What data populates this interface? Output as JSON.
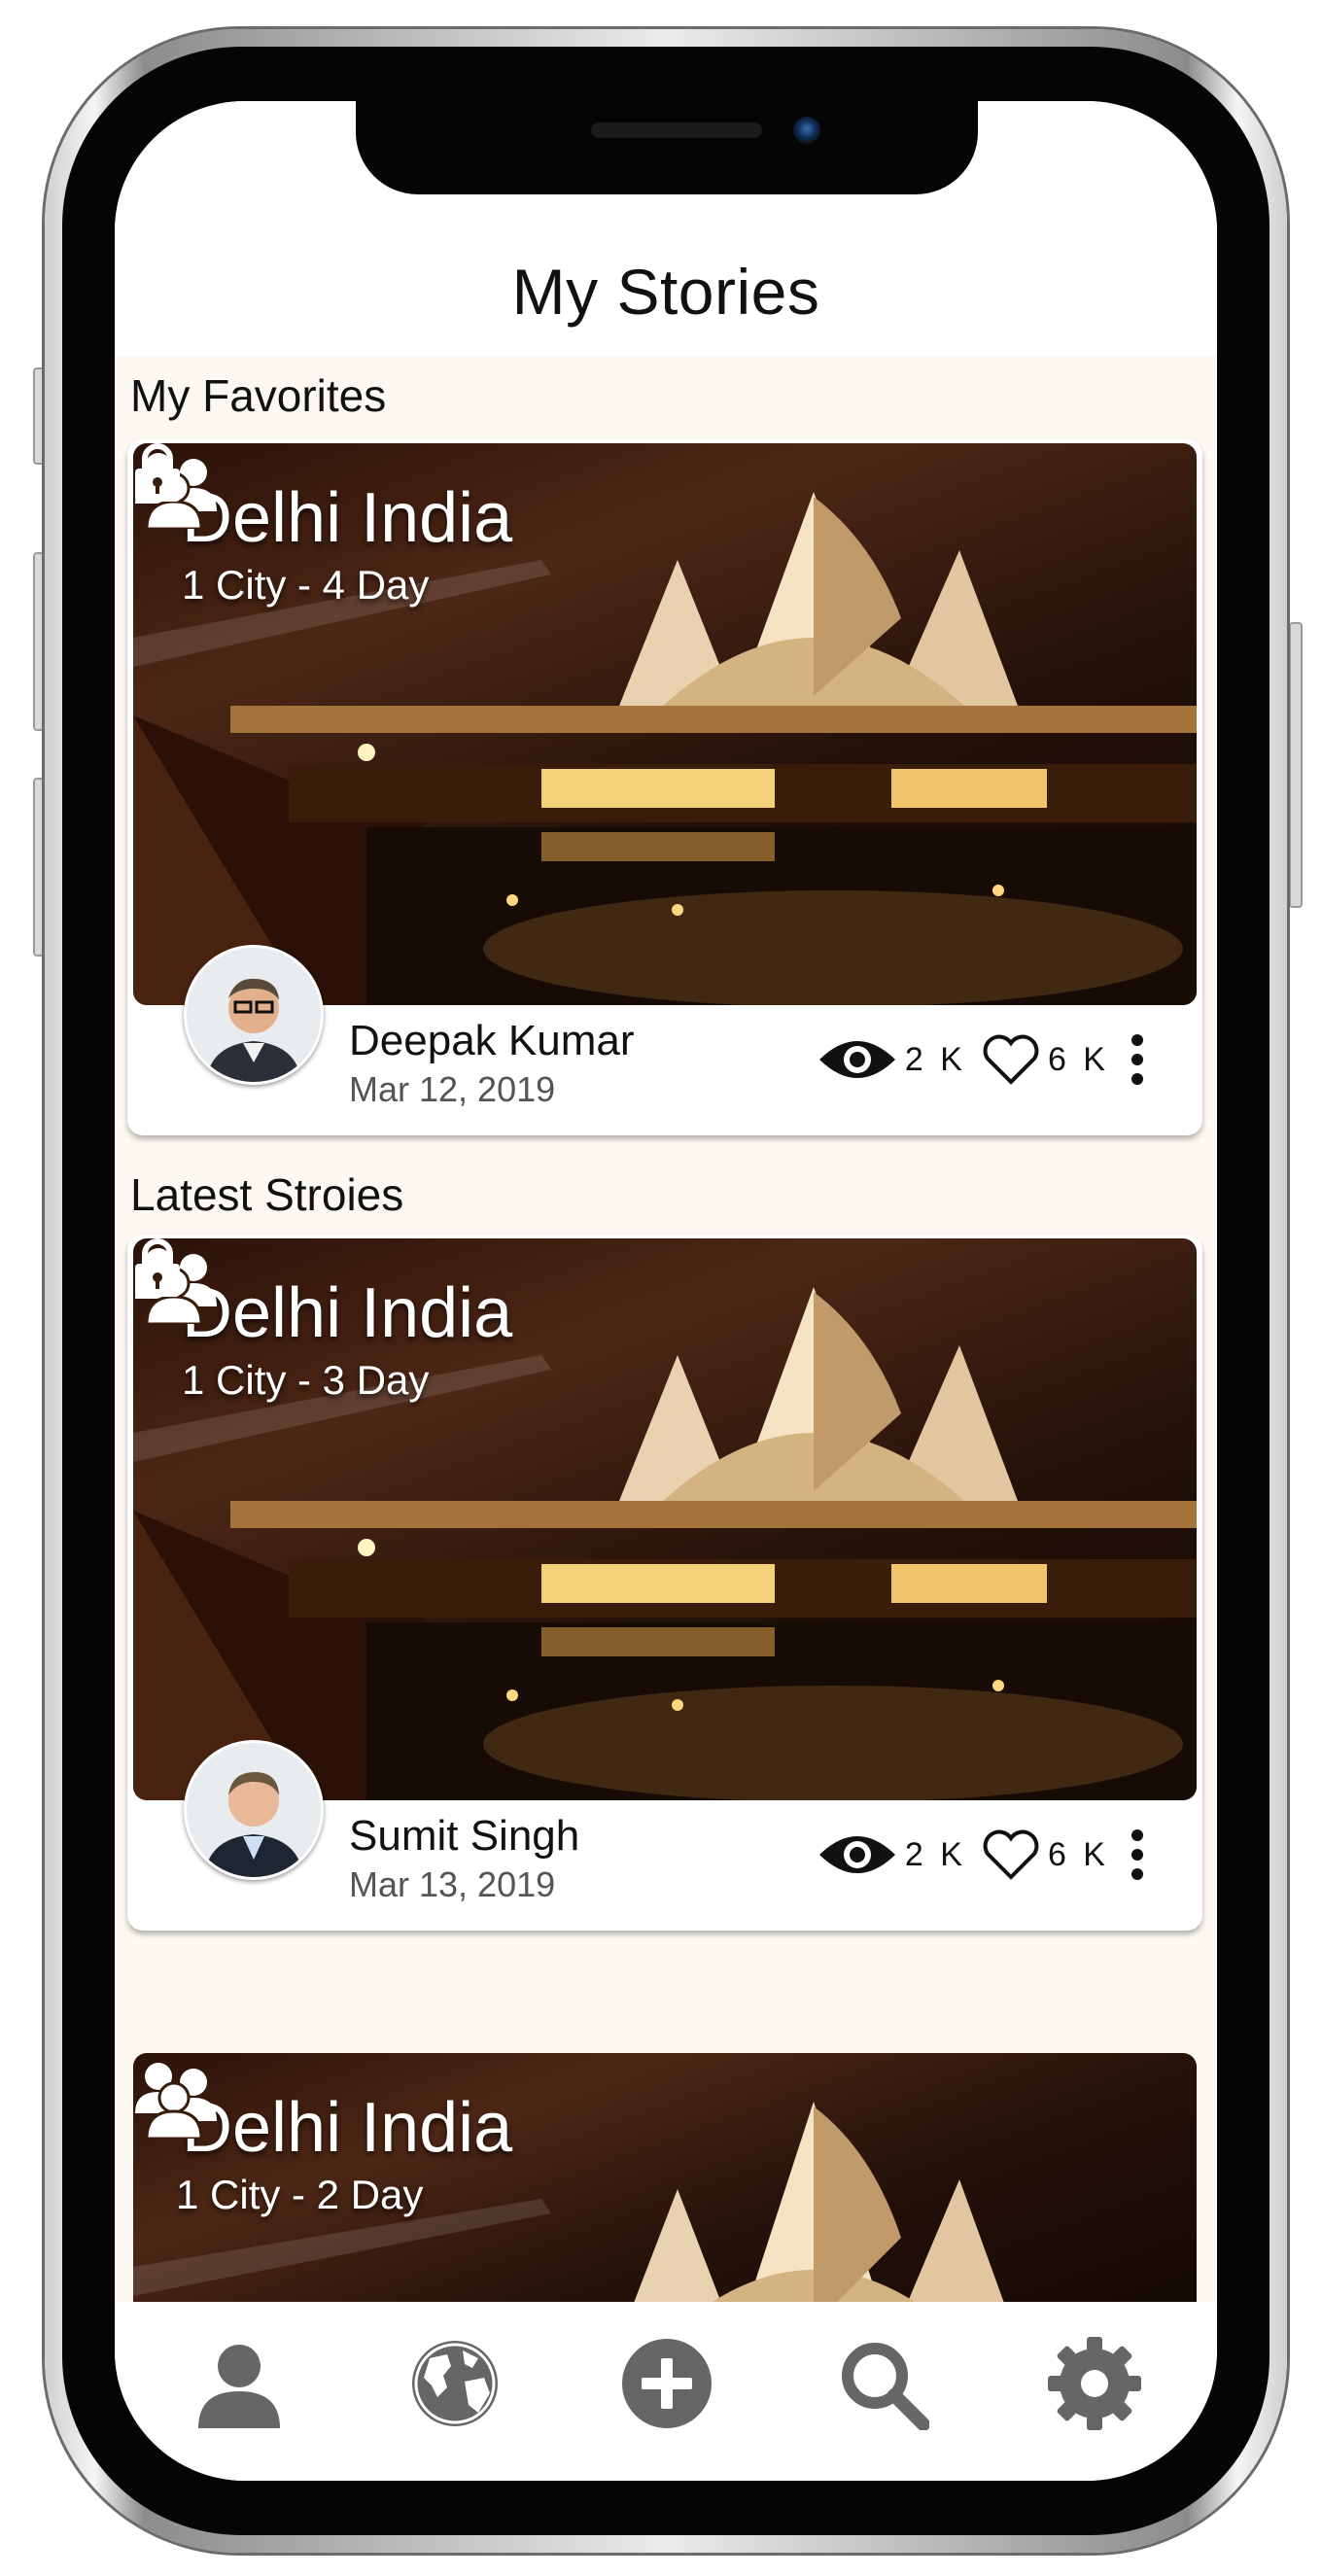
{
  "header": {
    "title": "My Stories"
  },
  "sections": {
    "favorites": "My Favorites",
    "latest": "Latest Stroies"
  },
  "stories": [
    {
      "city": "Delhi India",
      "duration": "1 City - 4 Day",
      "author": "Deepak Kumar",
      "date": "Mar 12, 2019",
      "views": "2 K",
      "likes": "6 K"
    },
    {
      "city": "Delhi India",
      "duration": "1 City - 3 Day",
      "author": "Sumit Singh",
      "date": "Mar 13, 2019",
      "views": "2 K",
      "likes": "6 K"
    },
    {
      "city": "Delhi India",
      "duration": "1 City - 2 Day"
    }
  ],
  "bottom_nav": {
    "icons": [
      "profile-icon",
      "globe-icon",
      "add-icon",
      "search-icon",
      "settings-icon"
    ],
    "icon_color": "#666666"
  },
  "colors": {
    "background": "#fbf9f1",
    "card": "#ffffff",
    "text": "#111111"
  }
}
